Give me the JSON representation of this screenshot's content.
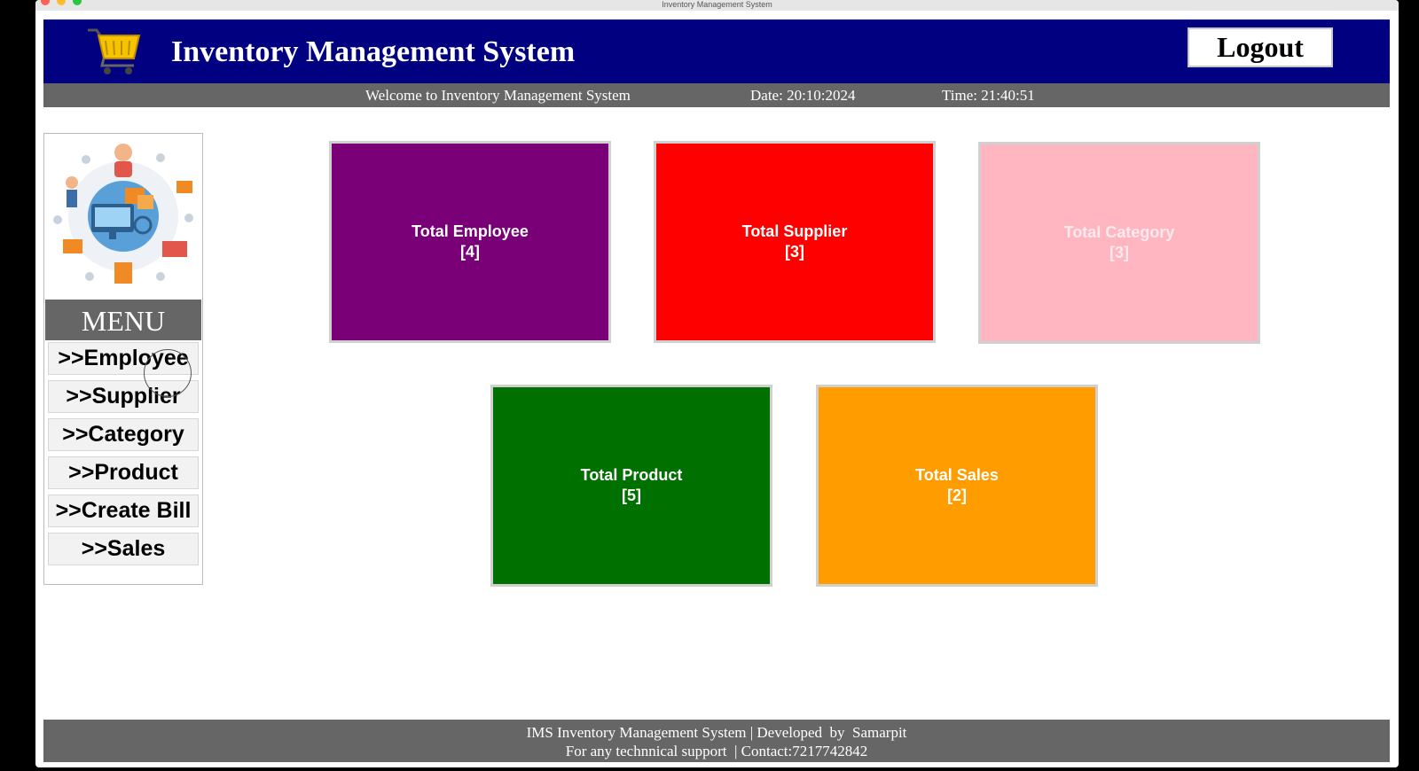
{
  "window": {
    "title": "Inventory Management System"
  },
  "header": {
    "title": "Inventory Management System",
    "logout_label": "Logout",
    "icon": "shopping-cart-icon"
  },
  "subheader": {
    "welcome": "Welcome to Inventory Management System",
    "date": "Date: 20:10:2024",
    "time": "Time: 21:40:51"
  },
  "sidebar": {
    "illustration": "inventory-illustration",
    "menu_title": "MENU",
    "items": [
      {
        "label": ">>Employee"
      },
      {
        "label": ">>Supplier"
      },
      {
        "label": ">>Category"
      },
      {
        "label": ">>Product"
      },
      {
        "label": ">>Create Bill"
      },
      {
        "label": ">>Sales"
      }
    ]
  },
  "tiles": [
    {
      "title": "Total Employee",
      "count": "[4]",
      "color": "#7a0078",
      "text_color": "#ffffff"
    },
    {
      "title": "Total Supplier",
      "count": "[3]",
      "color": "#ff0000",
      "text_color": "#ffffff"
    },
    {
      "title": "Total Category",
      "count": "[3]",
      "color": "#ffb6c1",
      "text_color": "#fbe9ee"
    },
    {
      "title": "Total Product",
      "count": "[5]",
      "color": "#007000",
      "text_color": "#ffffff"
    },
    {
      "title": "Total Sales",
      "count": "[2]",
      "color": "#ff9c00",
      "text_color": "#ffffff"
    }
  ],
  "footer": {
    "line1": "IMS Inventory Management System | Developed  by  Samarpit",
    "line2": "For any technnical support  | Contact:7217742842"
  }
}
